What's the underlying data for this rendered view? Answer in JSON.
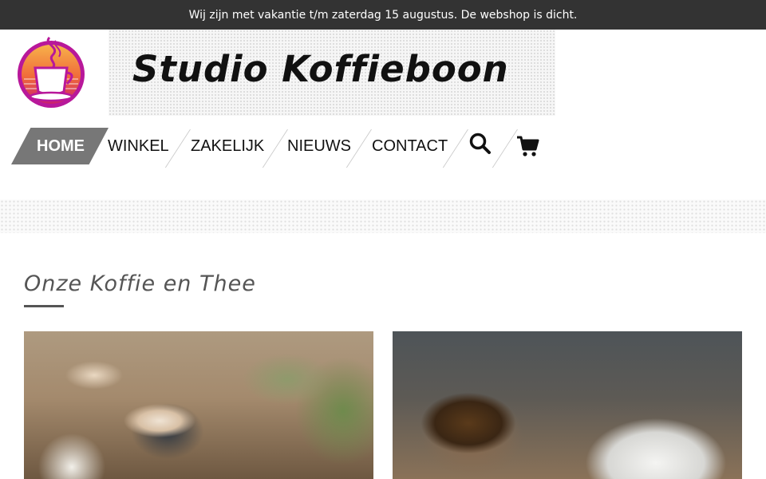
{
  "announcement": "Wij zijn met vakantie t/m zaterdag 15 augustus. De webshop is dicht.",
  "site": {
    "title": "Studio Koffieboon"
  },
  "nav": {
    "items": [
      "HOME",
      "WINKEL",
      "ZAKELIJK",
      "NIEUWS",
      "CONTACT"
    ],
    "active": "HOME",
    "search_icon": "search-icon",
    "cart_icon": "cart-icon"
  },
  "section": {
    "title": "Onze Koffie en Thee"
  },
  "cards": [
    {
      "subject": "coffee"
    },
    {
      "subject": "tea"
    }
  ],
  "colors": {
    "topbar": "#333333",
    "nav_active": "#777777",
    "section_title": "#555555"
  }
}
